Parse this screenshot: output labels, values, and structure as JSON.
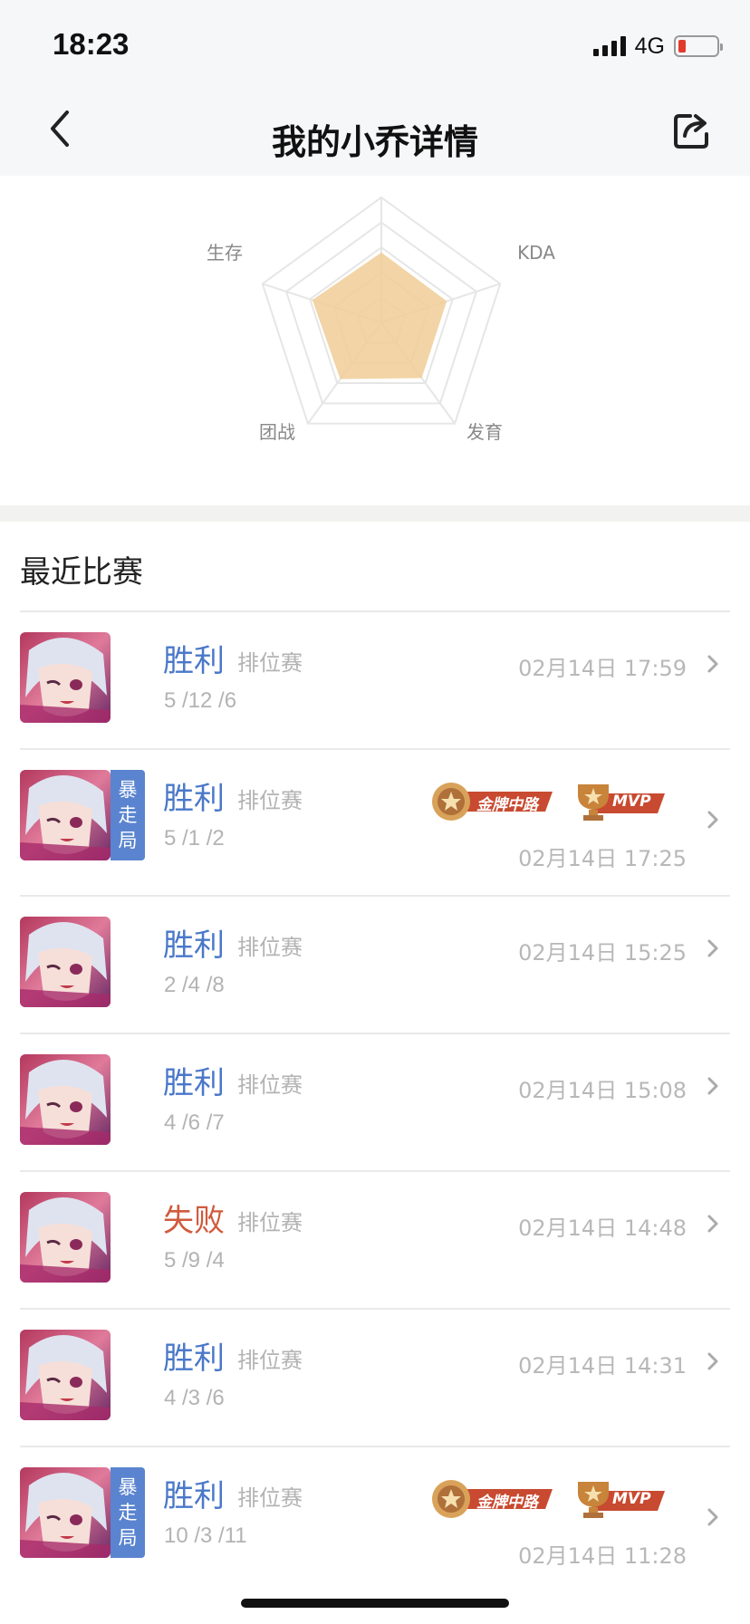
{
  "status_bar": {
    "time": "18:23",
    "network": "4G",
    "battery_color": "#e23b2e"
  },
  "nav": {
    "title": "我的小乔详情",
    "back_icon": "chevron-left-icon",
    "share_icon": "share-icon"
  },
  "radar": {
    "labels": {
      "survival": "生存",
      "kda": "KDA",
      "teamfight": "团战",
      "farming": "发育"
    },
    "values": [
      0.56,
      0.55,
      0.55,
      0.56,
      0.58
    ],
    "fill_color": "#f0cd96"
  },
  "recent": {
    "title": "最近比赛"
  },
  "matches": [
    {
      "result": "胜利",
      "outcome": "win",
      "mode": "排位赛",
      "kda": "5 /12 /6",
      "time": "02月14日 17:59",
      "rampage": false,
      "badges": []
    },
    {
      "result": "胜利",
      "outcome": "win",
      "mode": "排位赛",
      "kda": "5 /1 /2",
      "time": "02月14日 17:25",
      "rampage": true,
      "rampage_label": "暴走局",
      "badges": [
        "金牌中路",
        "MVP"
      ]
    },
    {
      "result": "胜利",
      "outcome": "win",
      "mode": "排位赛",
      "kda": "2 /4 /8",
      "time": "02月14日 15:25",
      "rampage": false,
      "badges": []
    },
    {
      "result": "胜利",
      "outcome": "win",
      "mode": "排位赛",
      "kda": "4 /6 /7",
      "time": "02月14日 15:08",
      "rampage": false,
      "badges": []
    },
    {
      "result": "失败",
      "outcome": "lose",
      "mode": "排位赛",
      "kda": "5 /9 /4",
      "time": "02月14日 14:48",
      "rampage": false,
      "badges": []
    },
    {
      "result": "胜利",
      "outcome": "win",
      "mode": "排位赛",
      "kda": "4 /3 /6",
      "time": "02月14日 14:31",
      "rampage": false,
      "badges": []
    },
    {
      "result": "胜利",
      "outcome": "win",
      "mode": "排位赛",
      "kda": "10 /3 /11",
      "time": "02月14日 11:28",
      "rampage": true,
      "rampage_label": "暴走局",
      "badges": [
        "金牌中路",
        "MVP"
      ]
    }
  ]
}
